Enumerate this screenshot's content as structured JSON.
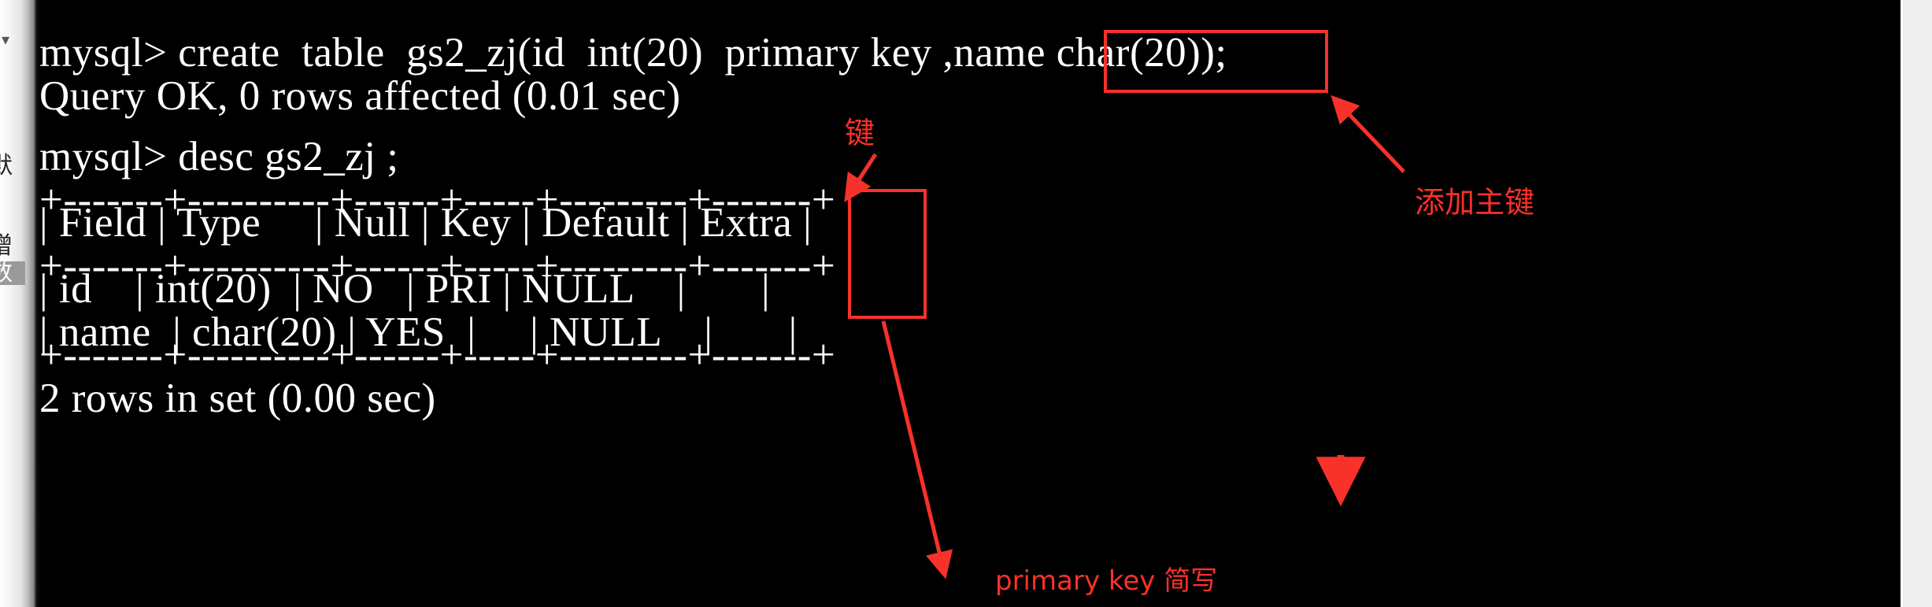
{
  "window": {
    "terminal_background": "#000000",
    "terminal_foreground": "#ffffff",
    "annotation_color": "#f8312b",
    "left_chrome_color": "#e9e9e9",
    "right_strip_color": "#efefef"
  },
  "left_chrome": {
    "caret_glyph": "▾",
    "clipped_labels": [
      {
        "text": "默",
        "selected": false
      },
      {
        "text": "增",
        "selected": false
      },
      {
        "text": "数",
        "selected": true
      }
    ]
  },
  "terminal": {
    "lines": [
      {
        "id": "clipped_top",
        "text": ""
      },
      {
        "id": "create_cmd",
        "text": "mysql> create  table  gs2_zj(id  int(20)  primary key ,name char(20));"
      },
      {
        "id": "query_ok",
        "text": "Query OK, 0 rows affected (0.01 sec)"
      },
      {
        "id": "blank1",
        "text": ""
      },
      {
        "id": "desc_cmd",
        "text": "mysql> desc gs2_zj ;"
      },
      {
        "id": "rule_top",
        "text": "+-------+----------+------+-----+---------+-------+"
      },
      {
        "id": "header_row",
        "text": "| Field | Type     | Null | Key | Default | Extra |"
      },
      {
        "id": "rule_mid",
        "text": "+-------+----------+------+-----+---------+-------+"
      },
      {
        "id": "row_id",
        "text": "| id    | int(20)  | NO   | PRI | NULL    |       |"
      },
      {
        "id": "row_name",
        "text": "| name  | char(20) | YES  |     | NULL    |       |"
      },
      {
        "id": "rule_bottom",
        "text": "+-------+----------+------+-----+---------+-------+"
      },
      {
        "id": "rows_in_set",
        "text": "2 rows in set (0.00 sec)"
      }
    ],
    "result_table": {
      "columns": [
        "Field",
        "Type",
        "Null",
        "Key",
        "Default",
        "Extra"
      ],
      "rows": [
        [
          "id",
          "int(20)",
          "NO",
          "PRI",
          "NULL",
          ""
        ],
        [
          "name",
          "char(20)",
          "YES",
          "",
          "NULL",
          ""
        ]
      ],
      "footer": "2 rows in set (0.00 sec)"
    }
  },
  "annotations": {
    "boxes": [
      {
        "id": "primary-key-box",
        "target": "primary key"
      },
      {
        "id": "key-column-box",
        "target": "Key / PRI"
      }
    ],
    "labels": [
      {
        "id": "add-primary-key",
        "text": "添加主键"
      },
      {
        "id": "key-label",
        "text": "键"
      },
      {
        "id": "primary-key-abbrev",
        "text": "primary key 简写"
      }
    ]
  }
}
